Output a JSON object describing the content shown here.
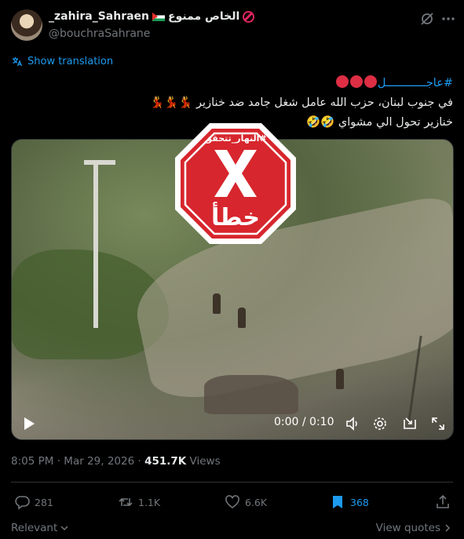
{
  "author": {
    "display_name": "_zahira_Sahraen",
    "name_suffix": "الخاص ممنوع",
    "handle": "@bouchraSahrane"
  },
  "translate_label": "Show translation",
  "tweet": {
    "hashtag": "#عاجــــــــــــل",
    "line2": "في جنوب لبنان،  حزب الله عامل شغل جامد  ضد خنازير 💃💃💃",
    "line3": "خنازير تحول الي مشواي 🤣🤣"
  },
  "overlay": {
    "label": "#النهار_تتحقق",
    "verdict": "خطأ",
    "color": "#d7262d"
  },
  "video": {
    "timecode": "0:00 / 0:10"
  },
  "meta": {
    "time": "8:05 PM",
    "separator": "·",
    "date": "Mar 29, 2026",
    "views_count": "451.7K",
    "views_label": "Views"
  },
  "actions": {
    "replies": "281",
    "reposts": "1.1K",
    "likes": "6.6K",
    "bookmarks": "368"
  },
  "footer": {
    "relevant": "Relevant",
    "view_quotes": "View quotes"
  },
  "colors": {
    "accent": "#1d9bf0",
    "muted": "#71767b",
    "background": "#000000"
  }
}
